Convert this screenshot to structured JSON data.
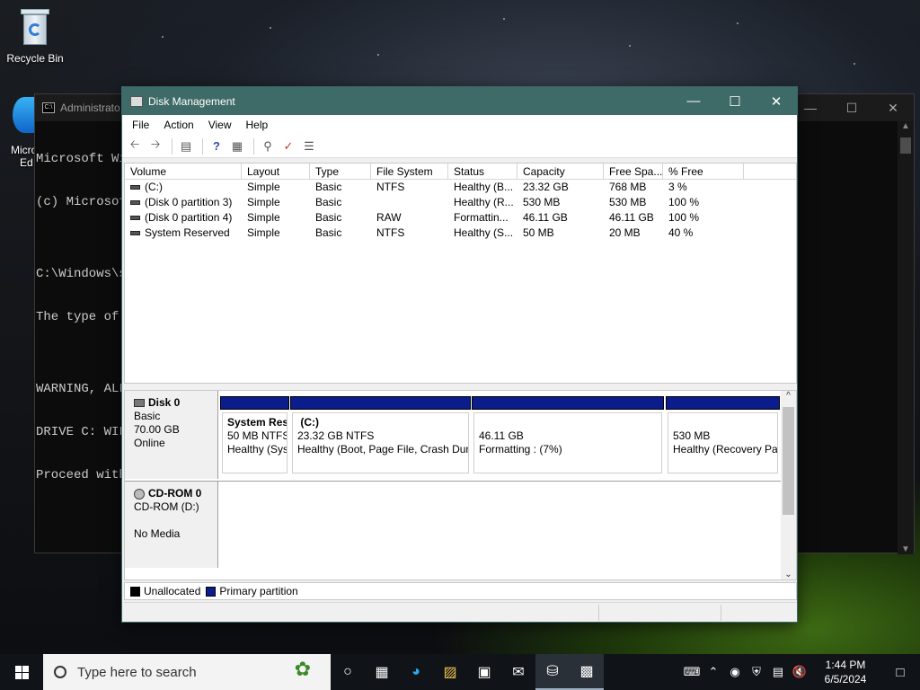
{
  "desktop": {
    "recycle_bin_label": "Recycle Bin",
    "edge_label_1": "Micro",
    "edge_label_2": "Ed"
  },
  "console": {
    "title": "Administrato",
    "lines": [
      "Microsoft Wi",
      "(c) Microsof",
      "",
      "C:\\Windows\\s",
      "The type of ",
      "",
      "WARNING, ALL",
      "DRIVE C: WIL",
      "Proceed with"
    ]
  },
  "window": {
    "title": "Disk Management",
    "accent": "#3e6b67"
  },
  "menu": [
    "File",
    "Action",
    "View",
    "Help"
  ],
  "toolbar_icons": [
    "back-icon",
    "forward-icon",
    "properties-icon",
    "help-icon",
    "console-icon",
    "search-icon",
    "check-icon",
    "list-icon"
  ],
  "columns": [
    "Volume",
    "Layout",
    "Type",
    "File System",
    "Status",
    "Capacity",
    "Free Spa...",
    "% Free"
  ],
  "volumes": [
    {
      "volume": "(C:)",
      "layout": "Simple",
      "type": "Basic",
      "fs": "NTFS",
      "status": "Healthy (B...",
      "capacity": "23.32 GB",
      "free": "768 MB",
      "pct": "3 %"
    },
    {
      "volume": "(Disk 0 partition 3)",
      "layout": "Simple",
      "type": "Basic",
      "fs": "",
      "status": "Healthy (R...",
      "capacity": "530 MB",
      "free": "530 MB",
      "pct": "100 %"
    },
    {
      "volume": "(Disk 0 partition 4)",
      "layout": "Simple",
      "type": "Basic",
      "fs": "RAW",
      "status": "Formattin...",
      "capacity": "46.11 GB",
      "free": "46.11 GB",
      "pct": "100 %"
    },
    {
      "volume": "System Reserved",
      "layout": "Simple",
      "type": "Basic",
      "fs": "NTFS",
      "status": "Healthy (S...",
      "capacity": "50 MB",
      "free": "20 MB",
      "pct": "40 %"
    }
  ],
  "disk0": {
    "name": "Disk 0",
    "type": "Basic",
    "size": "70.00 GB",
    "state": "Online",
    "partitions": [
      {
        "name": "System Res",
        "line2": "50 MB NTFS",
        "line3": "Healthy (Sys"
      },
      {
        "name": "(C:)",
        "line2": "23.32 GB NTFS",
        "line3": "Healthy (Boot, Page File, Crash Dun"
      },
      {
        "name": "",
        "line2": "46.11 GB",
        "line3": "Formatting : (7%)"
      },
      {
        "name": "",
        "line2": "530 MB",
        "line3": "Healthy (Recovery Pa"
      }
    ]
  },
  "cdrom": {
    "name": "CD-ROM 0",
    "drive": "CD-ROM (D:)",
    "media": "No Media"
  },
  "legend": {
    "unallocated": "Unallocated",
    "primary": "Primary partition",
    "unallocated_color": "#000000",
    "primary_color": "#0b1c8d"
  },
  "taskbar": {
    "search_placeholder": "Type here to search",
    "time": "1:44 PM",
    "date": "6/5/2024"
  }
}
